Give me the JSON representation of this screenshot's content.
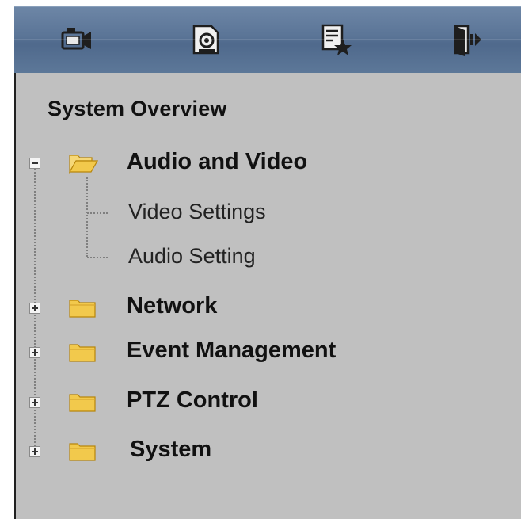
{
  "toolbar": {
    "buttons": [
      {
        "icon": "camera-live-view-icon"
      },
      {
        "icon": "playback-icon"
      },
      {
        "icon": "settings-favorite-icon"
      },
      {
        "icon": "logout-icon"
      }
    ]
  },
  "menu": {
    "overview_label": "System Overview",
    "nodes": [
      {
        "label": "Audio and Video",
        "expanded": true,
        "children": [
          {
            "label": "Video Settings"
          },
          {
            "label": "Audio Setting"
          }
        ]
      },
      {
        "label": "Network",
        "expanded": false
      },
      {
        "label": "Event Management",
        "expanded": false
      },
      {
        "label": "PTZ Control",
        "expanded": false
      },
      {
        "label": "System",
        "expanded": false
      }
    ]
  },
  "colors": {
    "toolbar": "#5a7496",
    "panel": "#c0c0c0",
    "folder": "#f2c94c"
  }
}
